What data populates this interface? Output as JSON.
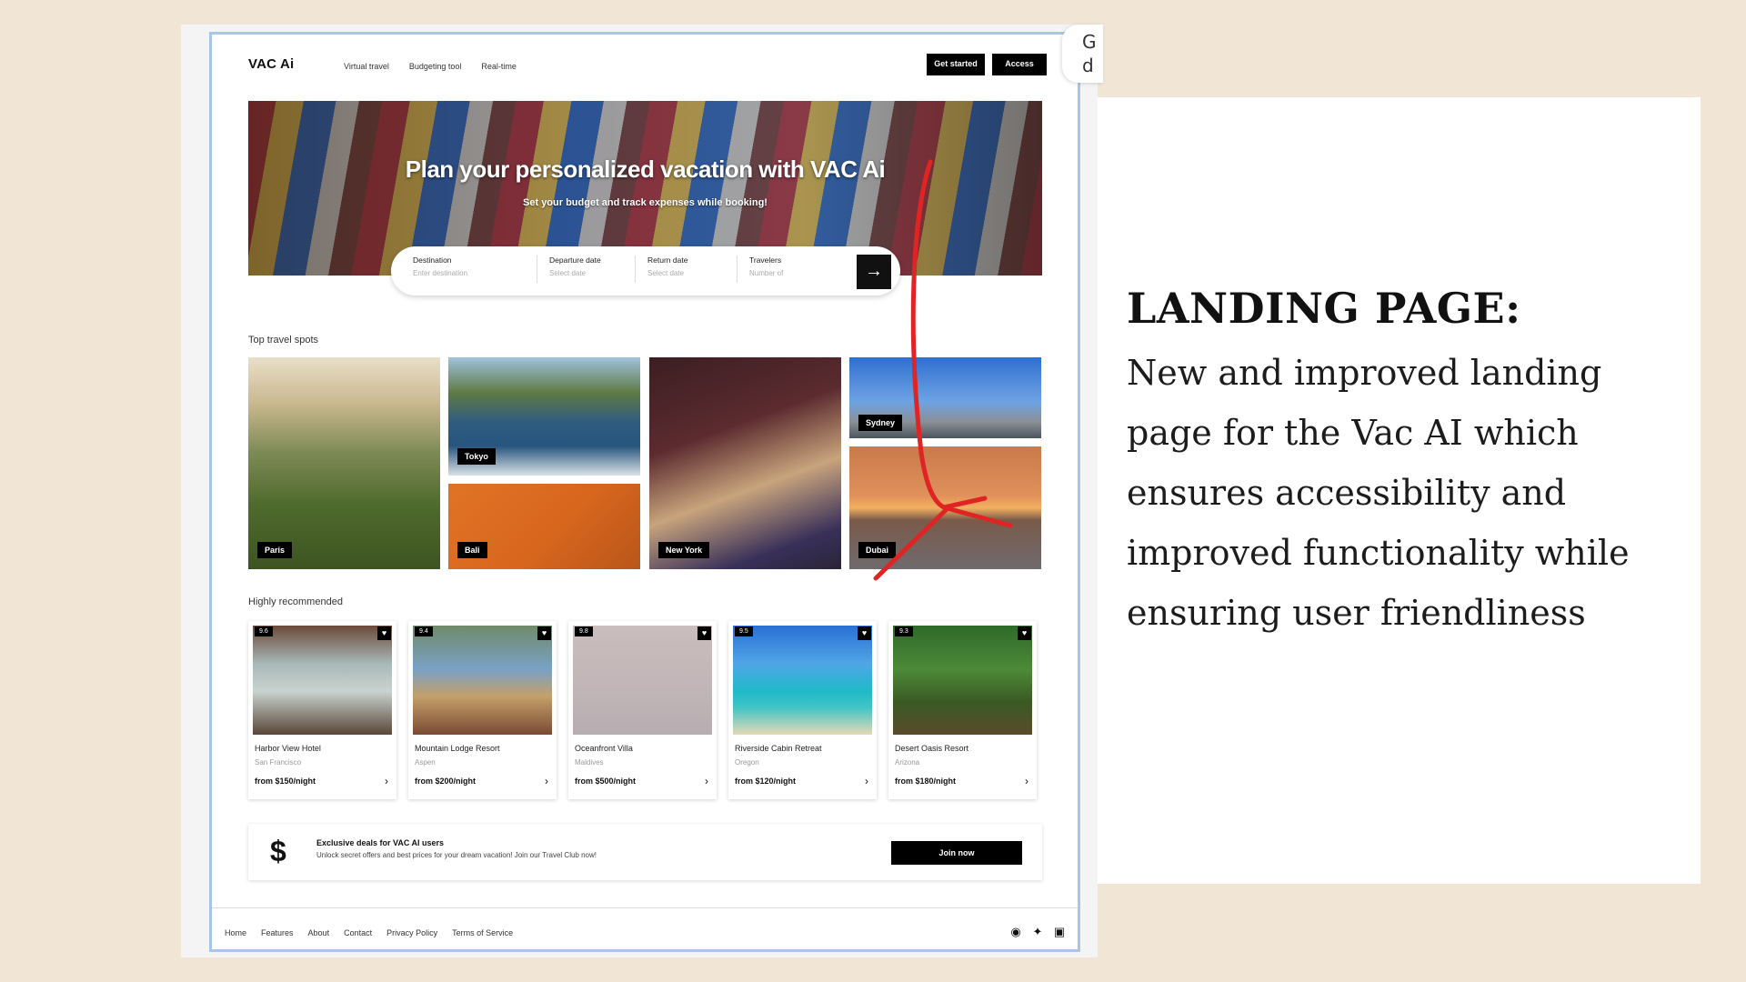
{
  "side_badge": "G\nd",
  "nav": {
    "logo": "VAC Ai",
    "links": [
      "Virtual travel",
      "Budgeting tool",
      "Real-time"
    ],
    "get_started": "Get started",
    "access_account": "Access account"
  },
  "hero": {
    "title": "Plan your personalized vacation with VAC Ai",
    "subtitle": "Set your budget and track expenses while booking!"
  },
  "search": {
    "fields": [
      {
        "label": "Destination",
        "placeholder": "Enter destination"
      },
      {
        "label": "Departure date",
        "placeholder": "Select date"
      },
      {
        "label": "Return date",
        "placeholder": "Select date"
      },
      {
        "label": "Travelers",
        "placeholder": "Number of"
      }
    ],
    "submit_icon": "arrow-right-icon"
  },
  "top_spots": {
    "title": "Top travel spots",
    "tiles": [
      "Paris",
      "Tokyo",
      "Bali",
      "New York",
      "Sydney",
      "Dubai"
    ]
  },
  "recommended": {
    "title": "Highly recommended",
    "cards": [
      {
        "name": "Harbor View Hotel",
        "location": "San Francisco",
        "price": "from $150/night",
        "rating": "9.6"
      },
      {
        "name": "Mountain Lodge Resort",
        "location": "Aspen",
        "price": "from $200/night",
        "rating": "9.4"
      },
      {
        "name": "Oceanfront Villa",
        "location": "Maldives",
        "price": "from $500/night",
        "rating": "9.8"
      },
      {
        "name": "Riverside Cabin Retreat",
        "location": "Oregon",
        "price": "from $120/night",
        "rating": "9.5"
      },
      {
        "name": "Desert Oasis Resort",
        "location": "Arizona",
        "price": "from $180/night",
        "rating": "9.3"
      }
    ]
  },
  "deal": {
    "icon": "dollar-icon",
    "title": "Exclusive deals for VAC AI users",
    "description": "Unlock secret offers and best prices for your dream vacation! Join our Travel Club now!",
    "button": "Join now"
  },
  "footer": {
    "links": [
      "Home",
      "Features",
      "About",
      "Contact",
      "Privacy Policy",
      "Terms of Service"
    ],
    "social_icons": [
      "facebook-icon",
      "twitter-icon",
      "instagram-icon"
    ]
  },
  "annotation": {
    "color": "#e02424"
  },
  "panel": {
    "heading": "LANDING PAGE:",
    "body": "New and improved landing page for the Vac AI which ensures accessibility and improved functionality while ensuring user friendliness"
  }
}
